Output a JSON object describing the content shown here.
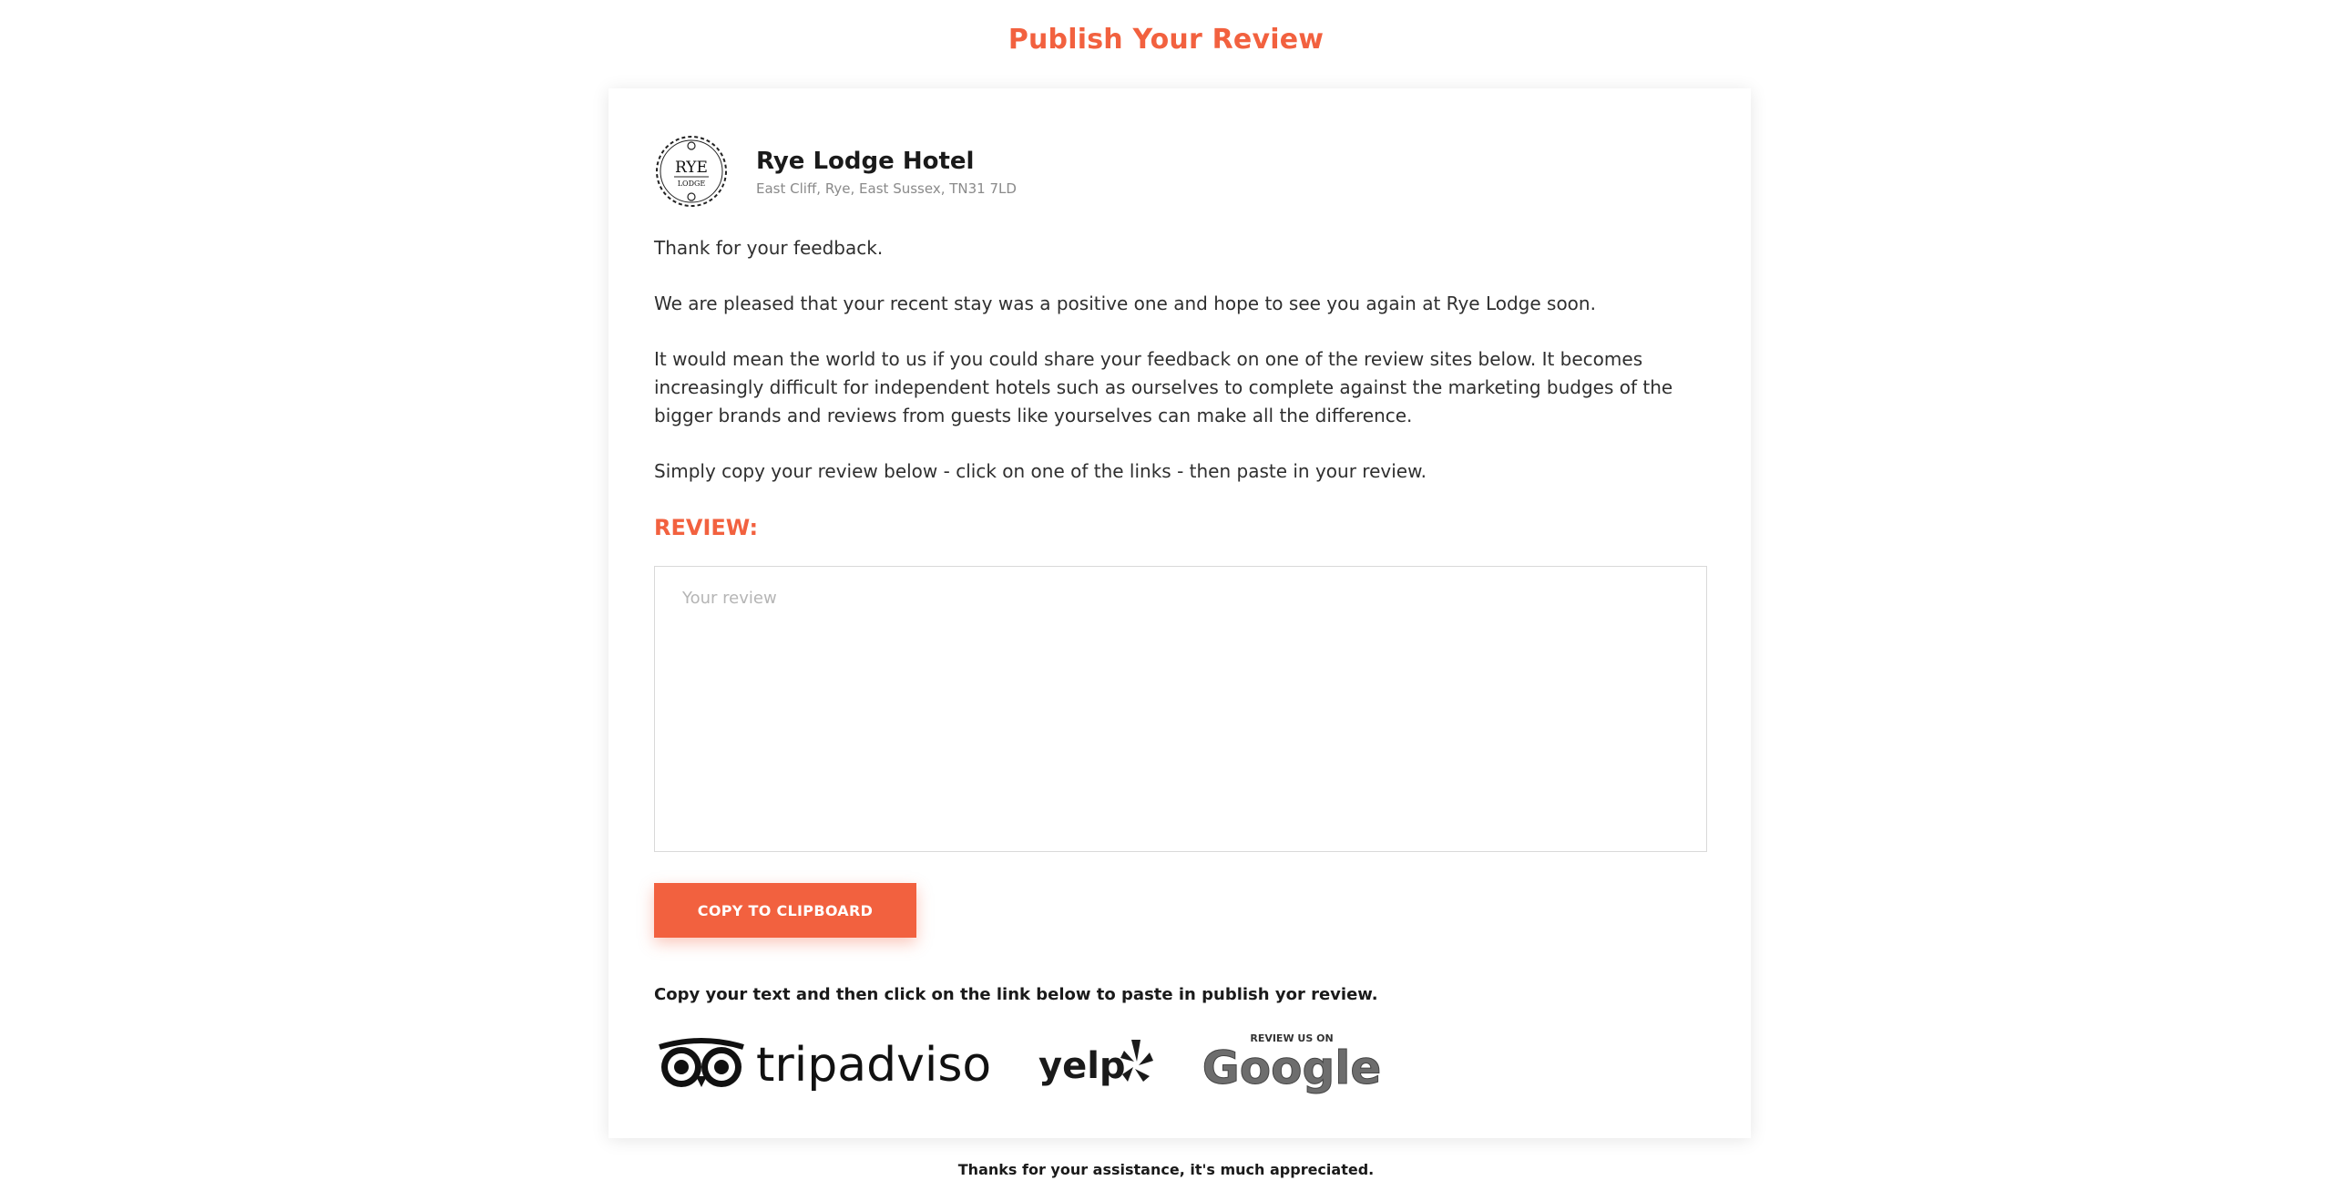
{
  "page": {
    "title": "Publish Your Review",
    "footer": "Thanks for your assistance, it's much appreciated."
  },
  "hotel": {
    "name": "Rye Lodge Hotel",
    "address": "East Cliff, Rye, East Sussex, TN31 7LD",
    "logo_top": "RYE",
    "logo_bottom": "LODGE"
  },
  "message": {
    "p1": "Thank for your feedback.",
    "p2": "We are pleased that your recent stay was a positive one and hope to see you again at Rye Lodge soon.",
    "p3": "It would mean the world to us if you could share your feedback on one of the review sites below. It becomes increasingly difficult for independent hotels such as ourselves to complete against the marketing budges of the bigger brands and reviews from guests like yourselves can make all the difference.",
    "p4": "Simply copy your review below - click on one of the links - then paste in your review."
  },
  "review": {
    "label": "REVIEW:",
    "placeholder": "Your review",
    "value": ""
  },
  "actions": {
    "copy_label": "COPY TO CLIPBOARD",
    "instruction": "Copy your text and then click on the link below to paste in publish yor review."
  },
  "review_sites": {
    "tripadvisor": "tripadvisor",
    "yelp": "yelp",
    "google_tag": "REVIEW US ON",
    "google": "Google"
  },
  "colors": {
    "accent": "#f2613f"
  }
}
